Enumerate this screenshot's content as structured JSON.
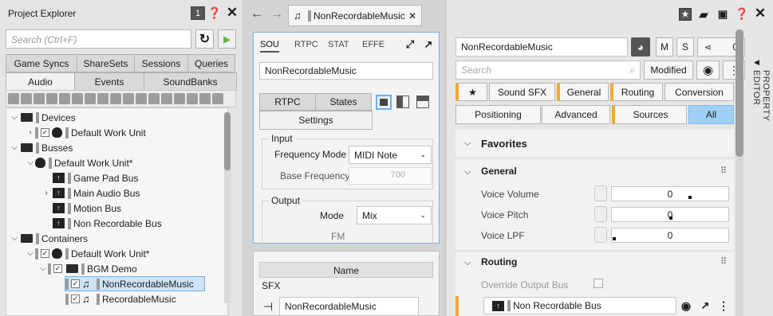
{
  "project_explorer": {
    "title": "Project Explorer",
    "badge": "1",
    "search_placeholder": "Search (Ctrl+F)",
    "tabs_row1": [
      "Game Syncs",
      "ShareSets",
      "Sessions",
      "Queries"
    ],
    "tabs_row2": [
      "Audio",
      "Events",
      "SoundBanks"
    ],
    "tree": [
      {
        "label": "Devices",
        "kind": "folder"
      },
      {
        "label": "Default Work Unit",
        "kind": "workunit"
      },
      {
        "label": "Busses",
        "kind": "folder"
      },
      {
        "label": "Default Work Unit*",
        "kind": "workunit"
      },
      {
        "label": "Game Pad Bus",
        "kind": "bus"
      },
      {
        "label": "Main Audio Bus",
        "kind": "bus"
      },
      {
        "label": "Motion Bus",
        "kind": "bus"
      },
      {
        "label": "Non Recordable Bus",
        "kind": "bus"
      },
      {
        "label": "Containers",
        "kind": "folder"
      },
      {
        "label": "Default Work Unit*",
        "kind": "workunit"
      },
      {
        "label": "BGM Demo",
        "kind": "folder"
      },
      {
        "label": "NonRecordableMusic",
        "kind": "sound",
        "selected": true
      },
      {
        "label": "RecordableMusic",
        "kind": "sound"
      }
    ]
  },
  "center": {
    "doc_tab": "NonRecordableMusic",
    "object_tabs": [
      "SOU",
      "RTPC",
      "STAT",
      "EFFE"
    ],
    "object_name": "NonRecordableMusic",
    "sub_tabs": [
      "RTPC",
      "States"
    ],
    "settings_tab": "Settings",
    "input_group": "Input",
    "frequency_mode_label": "Frequency Mode",
    "frequency_mode_value": "MIDI Note",
    "base_frequency_label": "Base Frequency",
    "base_frequency_value": "700",
    "output_group": "Output",
    "mode_label": "Mode",
    "mode_value": "Mix",
    "fm_label": "FM",
    "list_header": "Name",
    "list_group": "SFX",
    "list_item": "NonRecordableMusic"
  },
  "property_editor": {
    "object_name": "NonRecordableMusic",
    "m_label": "M",
    "s_label": "S",
    "ref_count": "0",
    "search_placeholder": "Search",
    "modified_label": "Modified",
    "side_label": "PROPERTY EDITOR",
    "tabs_row1": [
      "★",
      "Sound SFX",
      "General",
      "Routing",
      "Conversion"
    ],
    "tabs_row2": [
      "Positioning",
      "Advanced",
      "Sources",
      "All"
    ],
    "favorites_title": "Favorites",
    "general_title": "General",
    "voice_volume_label": "Voice Volume",
    "voice_volume_value": "0",
    "voice_pitch_label": "Voice Pitch",
    "voice_pitch_value": "0",
    "voice_lpf_label": "Voice LPF",
    "voice_lpf_value": "0",
    "routing_title": "Routing",
    "override_output_label": "Override Output Bus",
    "output_bus_value": "Non Recordable Bus"
  }
}
